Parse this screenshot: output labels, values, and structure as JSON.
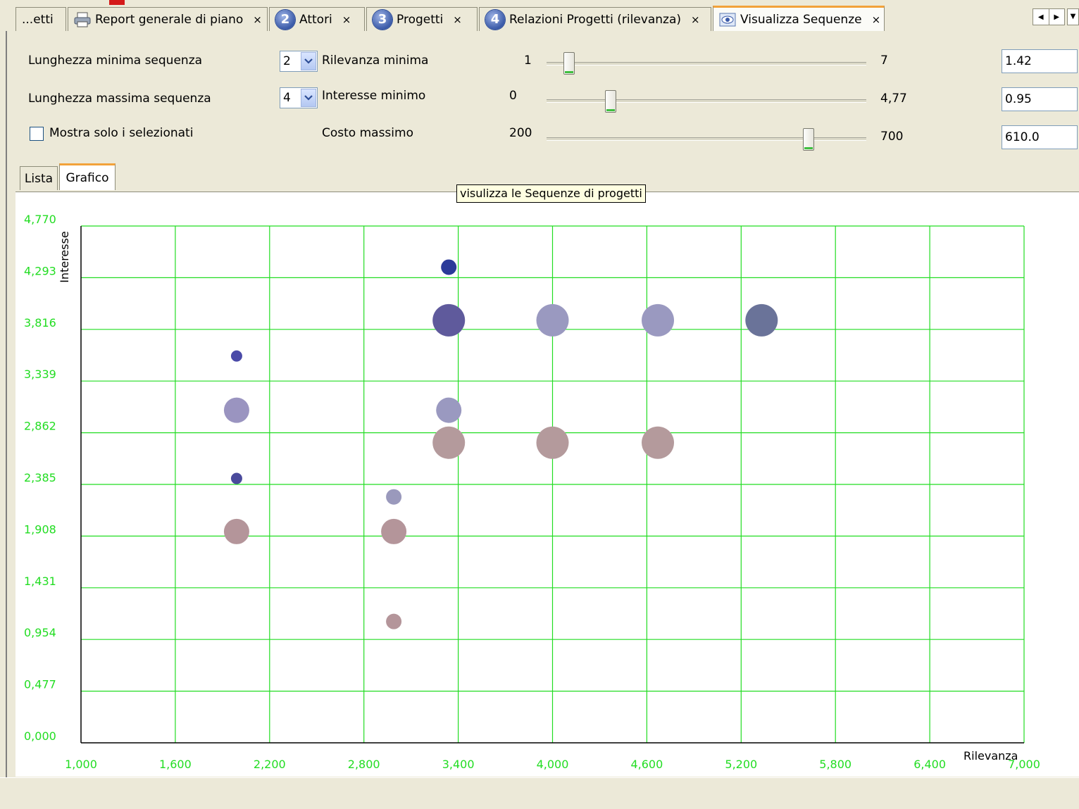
{
  "tabs": [
    {
      "label": "...etti",
      "icon": "none"
    },
    {
      "label": "Report generale di piano",
      "icon": "printer-icon"
    },
    {
      "label": "Attori",
      "icon": "number-2-icon",
      "num": "2"
    },
    {
      "label": "Progetti",
      "icon": "number-3-icon",
      "num": "3"
    },
    {
      "label": "Relazioni Progetti (rilevanza)",
      "icon": "number-4-icon",
      "num": "4"
    },
    {
      "label": "Visualizza Sequenze",
      "icon": "eye-icon",
      "active": true
    }
  ],
  "close_glyph": "×",
  "controls": {
    "min_length_label": "Lunghezza minima sequenza",
    "min_length_value": "2",
    "max_length_label": "Lunghezza massima sequenza",
    "max_length_value": "4",
    "only_selected_label": "Mostra solo i selezionati",
    "only_selected_checked": false,
    "relevance": {
      "label": "Rilevanza minima",
      "min": "1",
      "max": "7",
      "value": "1.42",
      "fraction": 0.07
    },
    "interest": {
      "label": "Interesse minimo",
      "min": "0",
      "max": "4,77",
      "value": "0.95",
      "fraction": 0.2
    },
    "cost": {
      "label": "Costo massimo",
      "min": "200",
      "max": "700",
      "value": "610.0",
      "fraction": 0.82
    }
  },
  "view_tabs": {
    "list": "Lista",
    "chart": "Grafico",
    "active": "Grafico"
  },
  "tooltip": "visulizza le Sequenze di progetti",
  "chart_data": {
    "type": "scatter",
    "xlabel": "Rilevanza",
    "ylabel": "Interesse",
    "xlim": [
      1.0,
      7.0
    ],
    "ylim": [
      0.0,
      4.77
    ],
    "x_ticks": [
      "1,000",
      "1,600",
      "2,200",
      "2,800",
      "3,400",
      "4,000",
      "4,600",
      "5,200",
      "5,800",
      "6,400",
      "7,000"
    ],
    "y_ticks": [
      "0,000",
      "0,477",
      "0,954",
      "1,431",
      "1,908",
      "2,385",
      "2,862",
      "3,339",
      "3,816",
      "4,293",
      "4,770"
    ],
    "grid": true,
    "grid_color": "#22dd22",
    "tick_color": "#22dd22",
    "points": [
      {
        "x": 3.34,
        "y": 4.39,
        "size": 1,
        "color": "#2b3a99"
      },
      {
        "x": 3.34,
        "y": 3.9,
        "size": 3,
        "color": "#5f5a9c"
      },
      {
        "x": 4.0,
        "y": 3.9,
        "size": 3,
        "color": "#9a99c0"
      },
      {
        "x": 4.67,
        "y": 3.9,
        "size": 3,
        "color": "#9a99c0"
      },
      {
        "x": 5.33,
        "y": 3.9,
        "size": 3,
        "color": "#6a7399"
      },
      {
        "x": 1.99,
        "y": 3.57,
        "size": 0,
        "color": "#4a4aa8"
      },
      {
        "x": 1.99,
        "y": 3.07,
        "size": 2,
        "color": "#9a94c0"
      },
      {
        "x": 3.34,
        "y": 3.07,
        "size": 2,
        "color": "#9a99c0"
      },
      {
        "x": 3.34,
        "y": 2.77,
        "size": 3,
        "color": "#b49a9c"
      },
      {
        "x": 4.0,
        "y": 2.77,
        "size": 3,
        "color": "#b49a9c"
      },
      {
        "x": 4.67,
        "y": 2.77,
        "size": 3,
        "color": "#b49a9c"
      },
      {
        "x": 1.99,
        "y": 2.44,
        "size": 0,
        "color": "#4a4a9c"
      },
      {
        "x": 2.99,
        "y": 2.27,
        "size": 1,
        "color": "#9a99bc"
      },
      {
        "x": 1.99,
        "y": 1.95,
        "size": 2,
        "color": "#b4959a"
      },
      {
        "x": 2.99,
        "y": 1.95,
        "size": 2,
        "color": "#b4959a"
      },
      {
        "x": 2.99,
        "y": 1.12,
        "size": 1,
        "color": "#b4959a"
      }
    ]
  }
}
